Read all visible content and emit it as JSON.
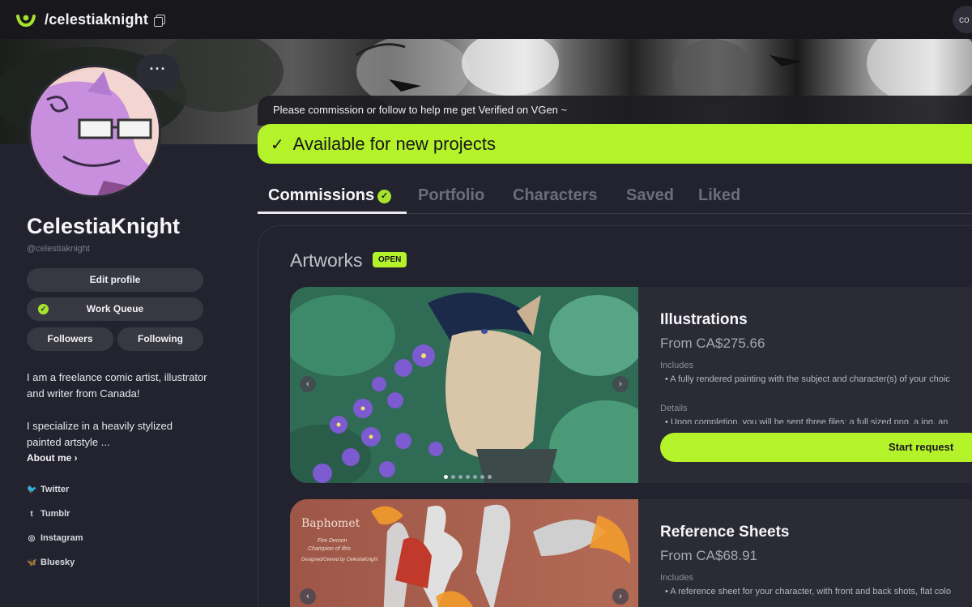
{
  "topbar": {
    "handle": "/celestiaknight",
    "logo_icon": "vgen-logo-icon",
    "right_button_label": "co"
  },
  "colors": {
    "accent": "#b4f22a",
    "background": "#23232f",
    "card": "#2b2b36",
    "topbar": "#17171c"
  },
  "profile": {
    "more_label": "···",
    "display_name": "CelestiaKnight",
    "username": "@celestiaknight",
    "buttons": {
      "edit": "Edit profile",
      "work_queue": "Work Queue",
      "followers": "Followers",
      "following": "Following"
    },
    "bio": [
      "I am a freelance comic artist, illustrator and writer from Canada!",
      "I specialize in a heavily stylized painted artstyle ..."
    ],
    "about_me": "About me ›",
    "socials": [
      {
        "icon": "twitter-icon",
        "glyph": "🐦",
        "label": "Twitter"
      },
      {
        "icon": "tumblr-icon",
        "glyph": "t",
        "label": "Tumblr"
      },
      {
        "icon": "instagram-icon",
        "glyph": "◎",
        "label": "Instagram"
      },
      {
        "icon": "bluesky-icon",
        "glyph": "🦋",
        "label": "Bluesky"
      }
    ]
  },
  "notice": "Please commission or follow to help me get Verified on VGen ~",
  "availability": {
    "check": "✓",
    "label": "Available for new projects"
  },
  "tabs": [
    {
      "label": "Commissions",
      "active": true
    },
    {
      "label": "Portfolio",
      "active": false
    },
    {
      "label": "Characters",
      "active": false
    },
    {
      "label": "Saved",
      "active": false
    },
    {
      "label": "Liked",
      "active": false
    }
  ],
  "section": {
    "title": "Artworks",
    "badge": "OPEN"
  },
  "commissions": [
    {
      "title": "Illustrations",
      "price": "From CA$275.66",
      "includes_label": "Includes",
      "includes_text": "• A fully rendered painting with the subject and character(s) of your choic",
      "details_label": "Details",
      "details_text": "• Upon completion, you will be sent three files: a full sized png, a jpg, an",
      "button": "Start request",
      "slides": 7,
      "current_slide": 1
    },
    {
      "title": "Reference Sheets",
      "price": "From CA$68.91",
      "includes_label": "Includes",
      "includes_text": "• A reference sheet for your character, with front and back shots, flat colo",
      "image_title": "Baphomet",
      "image_subtitle_1": "Fire Demon",
      "image_subtitle_2": "Champion of Ifris",
      "image_credit": "Designed/Owned by CelestiaKnight"
    }
  ]
}
